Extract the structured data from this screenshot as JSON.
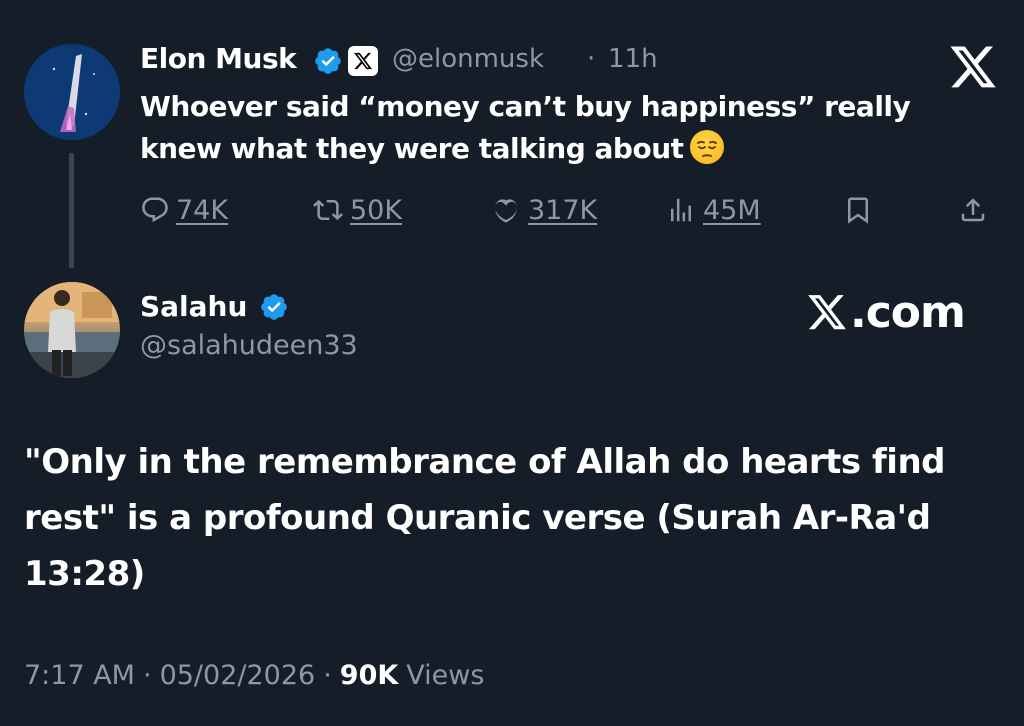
{
  "original_tweet": {
    "author_name": "Elon Musk",
    "handle": "@elonmusk",
    "separator": "·",
    "time_ago": "11h",
    "text": "Whoever said “money can’t buy happiness” really knew what they were talking about",
    "emoji": "pensive-face",
    "actions": {
      "replies": "74K",
      "reposts": "50K",
      "likes": "317K",
      "views": "45M"
    }
  },
  "reply": {
    "author_name": "Salahu",
    "handle": "@salahudeen33",
    "text": "\"Only in the remembrance of Allah do hearts find rest\" is a profound Quranic verse (Surah Ar-Ra'd 13:28)",
    "time": "7:17 AM",
    "separator": "·",
    "date": "05/02/2026",
    "views_count": "90K",
    "views_label": "Views"
  },
  "watermark": ".com",
  "colors": {
    "background": "#151d28",
    "muted": "#8b98a5",
    "verified": "#1d9bf0",
    "text": "#ffffff"
  },
  "icons": [
    "x-logo-icon",
    "verified-badge-icon",
    "reply-icon",
    "repost-icon",
    "like-icon",
    "views-icon",
    "bookmark-icon",
    "share-icon"
  ]
}
